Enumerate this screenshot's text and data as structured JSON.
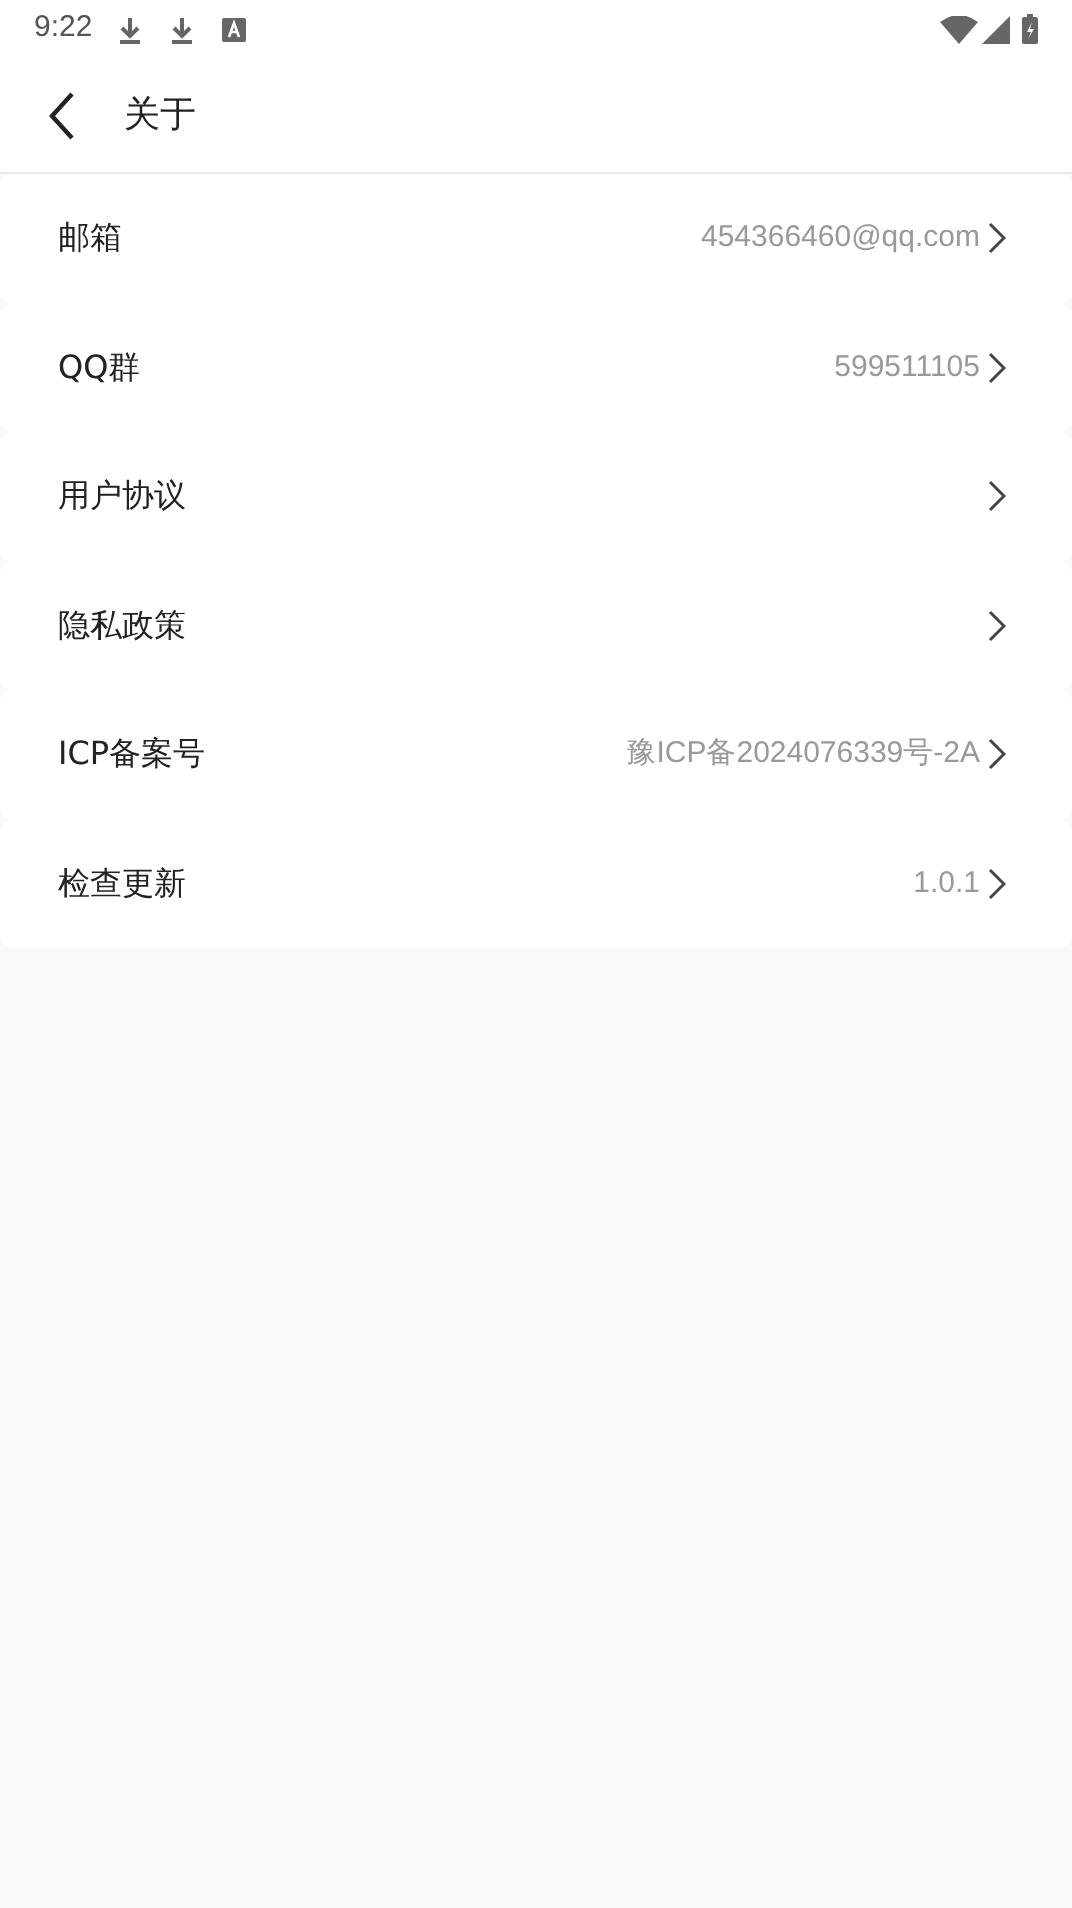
{
  "status_bar": {
    "time": "9:22"
  },
  "header": {
    "title": "关于"
  },
  "items": [
    {
      "label": "邮箱",
      "value": "454366460@qq.com"
    },
    {
      "label": "QQ群",
      "value": "599511105"
    },
    {
      "label": "用户协议"
    },
    {
      "label": "隐私政策"
    },
    {
      "label": "ICP备案号",
      "value": "豫ICP备2024076339号-2A"
    },
    {
      "label": "检查更新",
      "value": "1.0.1"
    }
  ]
}
